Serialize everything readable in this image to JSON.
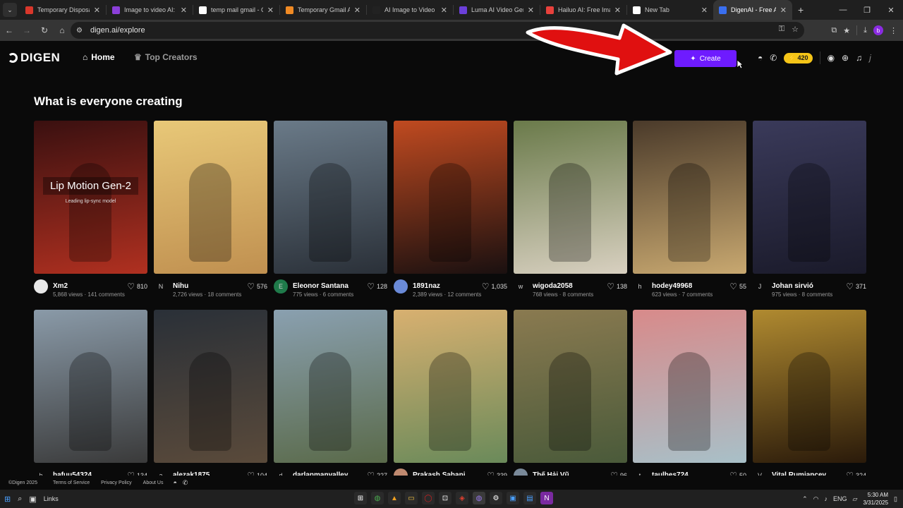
{
  "browser": {
    "tabs": [
      {
        "title": "Temporary Disposab",
        "favicon_color": "#d9372b"
      },
      {
        "title": "Image to video AI: Co",
        "favicon_color": "#8b3fd9"
      },
      {
        "title": "temp mail gmail - Go",
        "favicon_color": "#ffffff"
      },
      {
        "title": "Temporary Gmail Acc",
        "favicon_color": "#f08a24"
      },
      {
        "title": "AI Image to Video Ge",
        "favicon_color": "#222222"
      },
      {
        "title": "Luma AI Video Gene",
        "favicon_color": "#6b3fd9"
      },
      {
        "title": "Hailuo AI: Free Image",
        "favicon_color": "#e8413c"
      },
      {
        "title": "New Tab",
        "favicon_color": "#ffffff"
      },
      {
        "title": "DigenAI - Free AI Vid",
        "favicon_color": "#3a6ff0",
        "active": true
      }
    ],
    "url": "digen.ai/explore"
  },
  "site": {
    "logo": "DIGEN",
    "nav": {
      "home": "Home",
      "top_creators": "Top Creators"
    },
    "create_label": "Create",
    "credits": "420",
    "section_title": "What is everyone creating",
    "overlay_title": "Lip Motion Gen-2",
    "overlay_sub": "Leading lip-sync model"
  },
  "cards": [
    {
      "user": "Xm2",
      "likes": "810",
      "stats": "5,868 views · 141 comments",
      "avatar": "",
      "avatar_bg": "#e8e8e8",
      "bg": [
        "#3a1010",
        "#b03020"
      ]
    },
    {
      "user": "Nihu",
      "likes": "576",
      "stats": "2,726 views · 18 comments",
      "avatar": "N",
      "avatar_bg": "#0a0a0a",
      "bg": [
        "#e8c878",
        "#c09050"
      ]
    },
    {
      "user": "Eleonor Santana",
      "likes": "128",
      "stats": "775 views · 6 comments",
      "avatar": "E",
      "avatar_bg": "#1f7a4a",
      "bg": [
        "#6a7a88",
        "#2a3038"
      ]
    },
    {
      "user": "1891naz",
      "likes": "1,035",
      "stats": "2,389 views · 12 comments",
      "avatar": "",
      "avatar_bg": "#6a8ad8",
      "bg": [
        "#c04a20",
        "#1a1010"
      ]
    },
    {
      "user": "wigoda2058",
      "likes": "138",
      "stats": "768 views · 8 comments",
      "avatar": "w",
      "avatar_bg": "#0a0a0a",
      "bg": [
        "#6a7a4a",
        "#d8d0c0"
      ]
    },
    {
      "user": "hodey49968",
      "likes": "55",
      "stats": "623 views · 7 comments",
      "avatar": "h",
      "avatar_bg": "#0a0a0a",
      "bg": [
        "#4a3a2a",
        "#c8a870"
      ]
    },
    {
      "user": "Johan sirvió",
      "likes": "371",
      "stats": "975 views · 8 comments",
      "avatar": "J",
      "avatar_bg": "#0a0a0a",
      "bg": [
        "#3a3a5a",
        "#1a1a2a"
      ]
    },
    {
      "user": "hafuu54324",
      "likes": "134",
      "stats": "",
      "avatar": "h",
      "avatar_bg": "#0a0a0a",
      "bg": [
        "#8a9aa8",
        "#3a3a3a"
      ]
    },
    {
      "user": "alezak1875",
      "likes": "104",
      "stats": "",
      "avatar": "a",
      "avatar_bg": "#0a0a0a",
      "bg": [
        "#2a3038",
        "#5a4a3a"
      ]
    },
    {
      "user": "darlanmanvalley",
      "likes": "227",
      "stats": "",
      "avatar": "d",
      "avatar_bg": "#0a0a0a",
      "bg": [
        "#8aa0b0",
        "#5a6a4a"
      ]
    },
    {
      "user": "Prakash Sahani",
      "likes": "339",
      "stats": "",
      "avatar": "",
      "avatar_bg": "#c08a70",
      "bg": [
        "#d8b070",
        "#6a8a5a"
      ]
    },
    {
      "user": "Thế Hải Vũ",
      "likes": "96",
      "stats": "",
      "avatar": "",
      "avatar_bg": "#7a8a9a",
      "bg": [
        "#8a7a50",
        "#4a5a3a"
      ]
    },
    {
      "user": "taulhes724",
      "likes": "50",
      "stats": "",
      "avatar": "t",
      "avatar_bg": "#0a0a0a",
      "bg": [
        "#d88a8a",
        "#a8c0c8"
      ]
    },
    {
      "user": "Vital Rumiancev",
      "likes": "324",
      "stats": "",
      "avatar": "V",
      "avatar_bg": "#0a0a0a",
      "bg": [
        "#b08a30",
        "#2a1a0a"
      ]
    }
  ],
  "footer": {
    "copyright": "©Digen 2025",
    "terms": "Terms of Service",
    "privacy": "Privacy Policy",
    "about": "About Us"
  },
  "taskbar": {
    "links": "Links",
    "lang": "ENG",
    "time": "5:30 AM",
    "date": "3/31/2025"
  }
}
